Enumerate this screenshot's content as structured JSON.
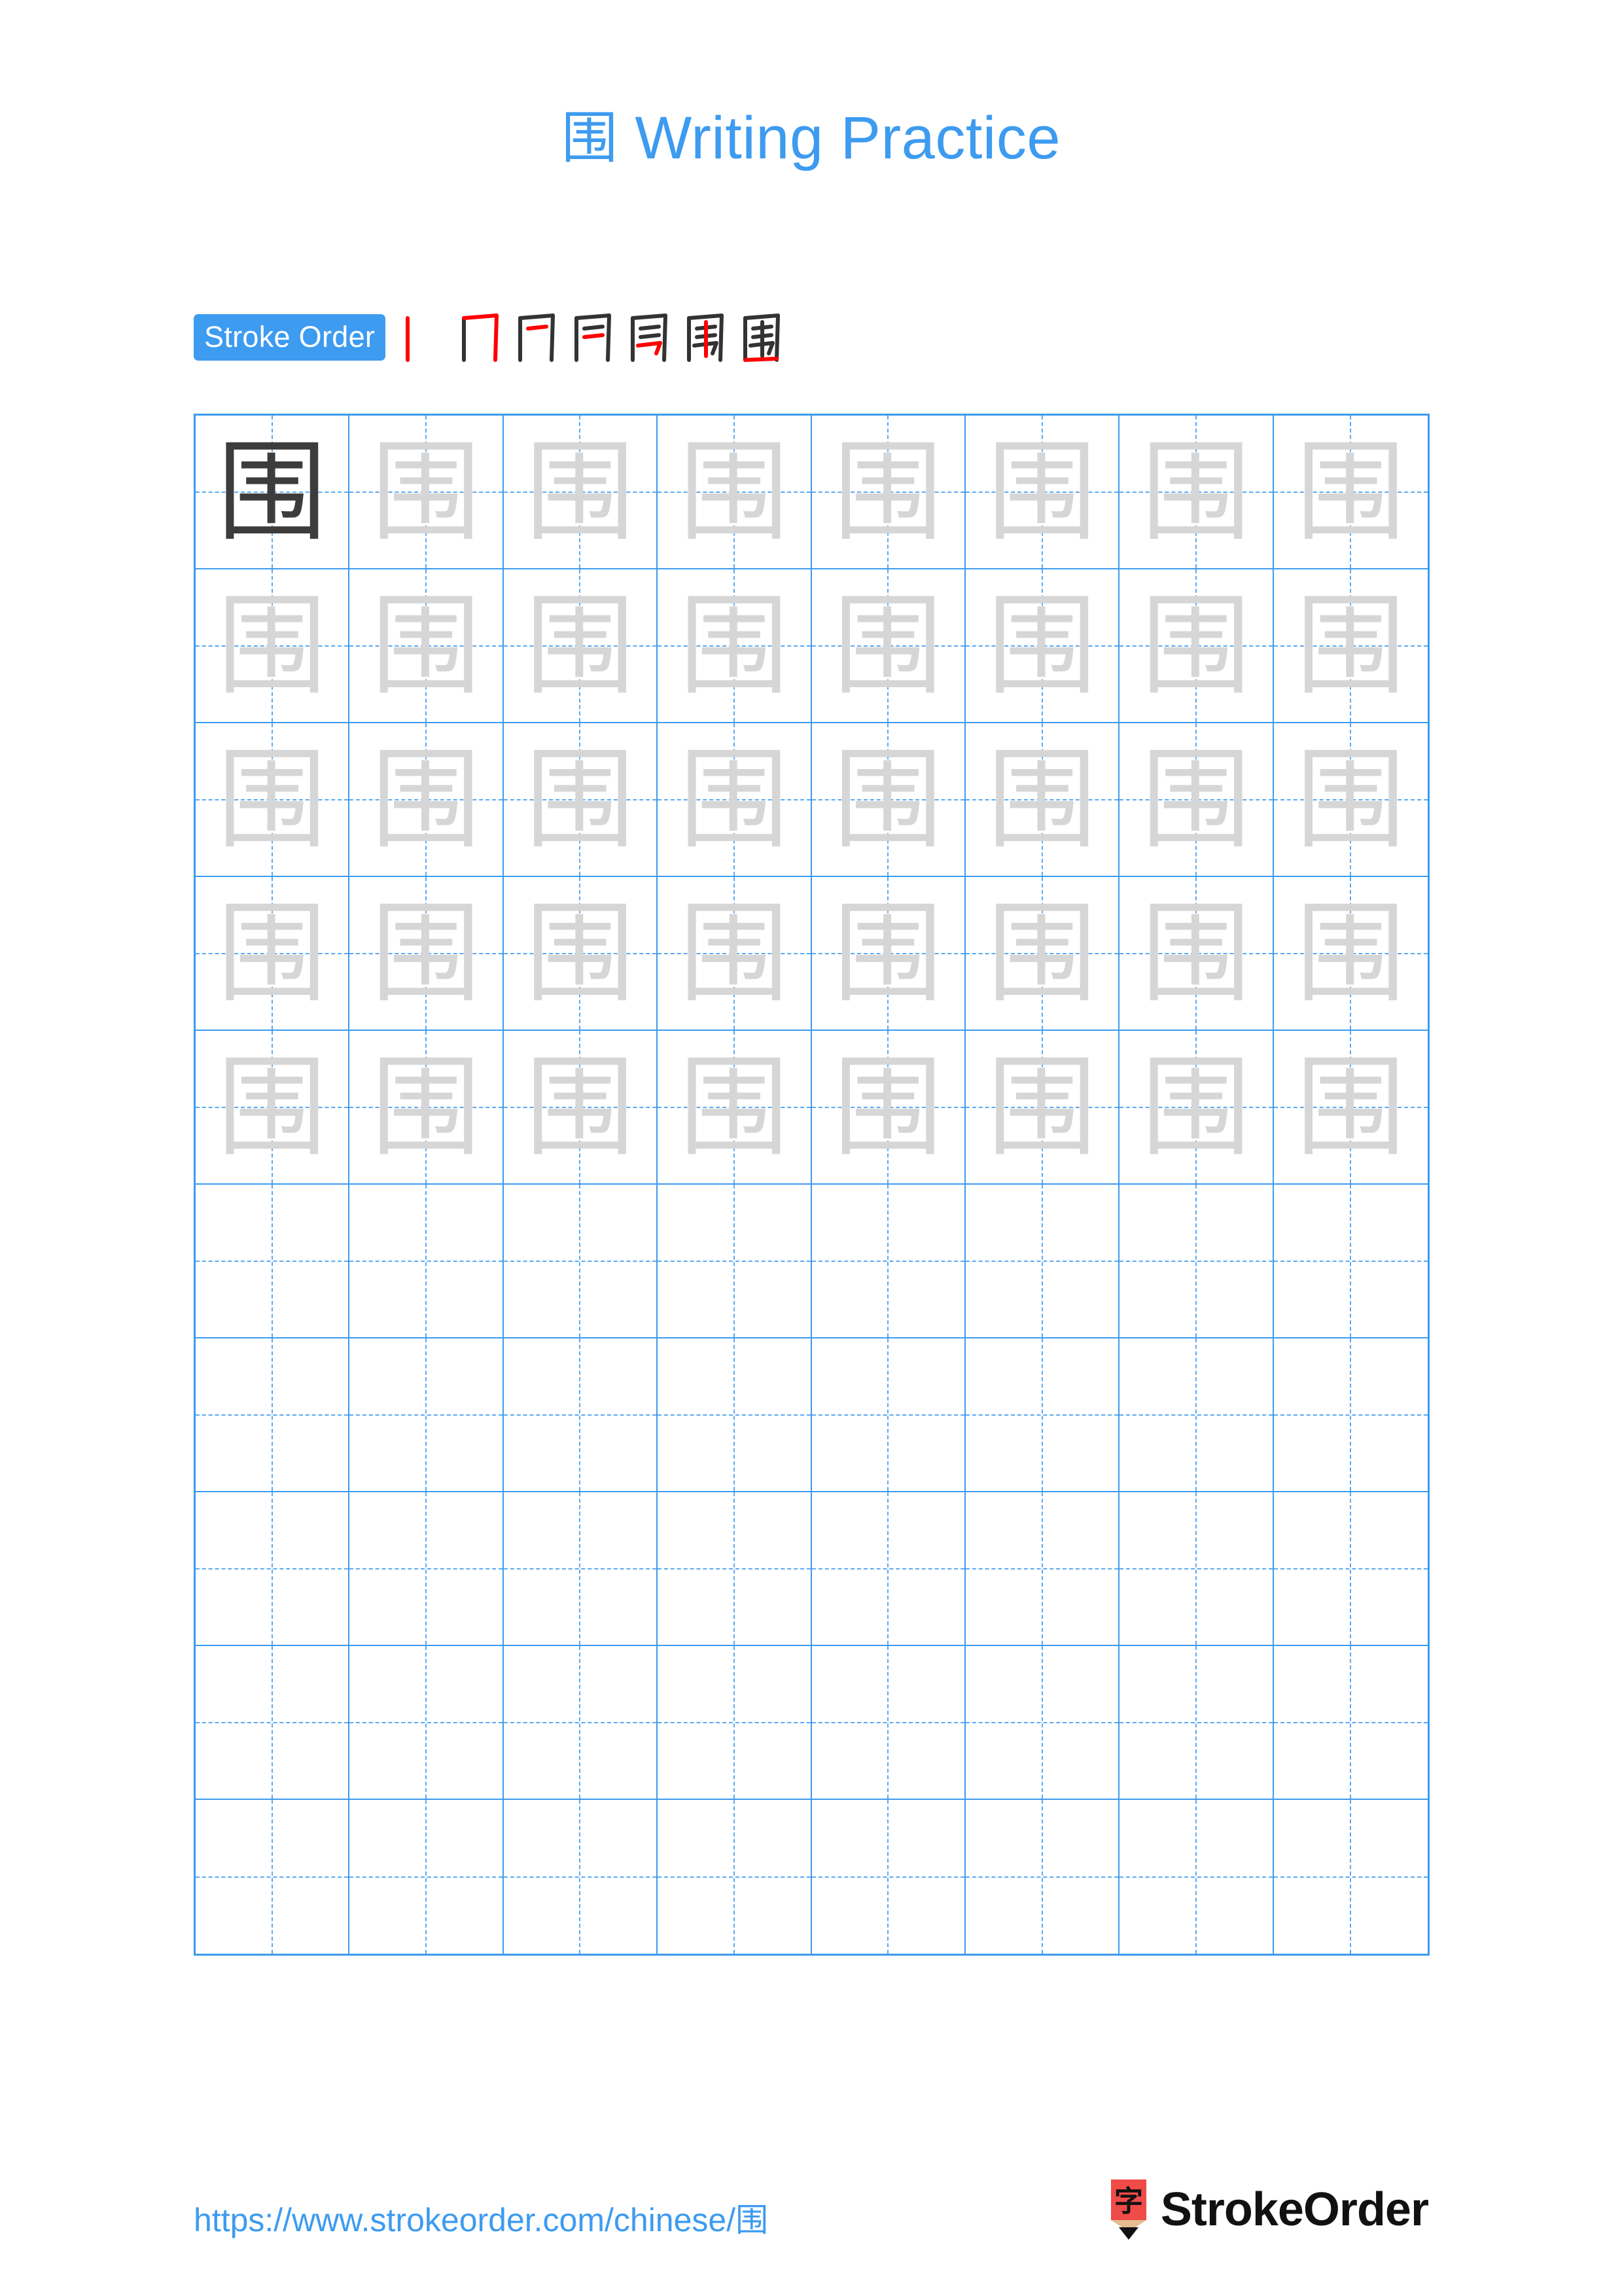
{
  "character": "围",
  "title": {
    "character": "围",
    "text": "Writing Practice",
    "full": "围 Writing Practice"
  },
  "stroke_order": {
    "badge_label": "Stroke Order",
    "stroke_count": 7,
    "steps": [
      {
        "index": 1,
        "glyph": "丨",
        "new_stroke": "vertical-left",
        "new_stroke_color": "#ff0000"
      },
      {
        "index": 2,
        "glyph": "冂",
        "new_stroke": "horizontal-top-and-vertical-right-hook",
        "new_stroke_color": "#ff0000"
      },
      {
        "index": 3,
        "glyph": "𠀃",
        "new_stroke": "horizontal-inner-first",
        "new_stroke_color": "#ff0000"
      },
      {
        "index": 4,
        "glyph": "冃",
        "new_stroke": "horizontal-inner-second",
        "new_stroke_color": "#ff0000"
      },
      {
        "index": 5,
        "glyph": "冐",
        "new_stroke": "horizontal-pie-third",
        "new_stroke_color": "#ff0000"
      },
      {
        "index": 6,
        "glyph": "韦",
        "new_stroke": "vertical-center",
        "new_stroke_color": "#ff0000"
      },
      {
        "index": 7,
        "glyph": "围",
        "new_stroke": "horizontal-bottom-close",
        "new_stroke_color": "#ff0000"
      }
    ]
  },
  "grid": {
    "columns": 8,
    "rows": 10,
    "filled_rows": 5,
    "empty_rows": 5,
    "model_cell": {
      "row": 1,
      "column": 1,
      "style": "dark"
    },
    "trace_style": "light-gray"
  },
  "footer": {
    "url": "https://www.strokeorder.com/chinese/围",
    "brand_name": "StrokeOrder",
    "brand_logo_char": "字"
  },
  "colors": {
    "accent_blue": "#3d9bf0",
    "grid_line": "#3d9bf0",
    "guide_line": "#5aa9f2",
    "model_char": "#3c3c3c",
    "trace_char": "#d6d6d6",
    "stroke_new": "#ff0000",
    "stroke_old": "#333333",
    "logo_red": "#ef4b48",
    "logo_wood": "#e3bd90",
    "background": "#ffffff"
  }
}
